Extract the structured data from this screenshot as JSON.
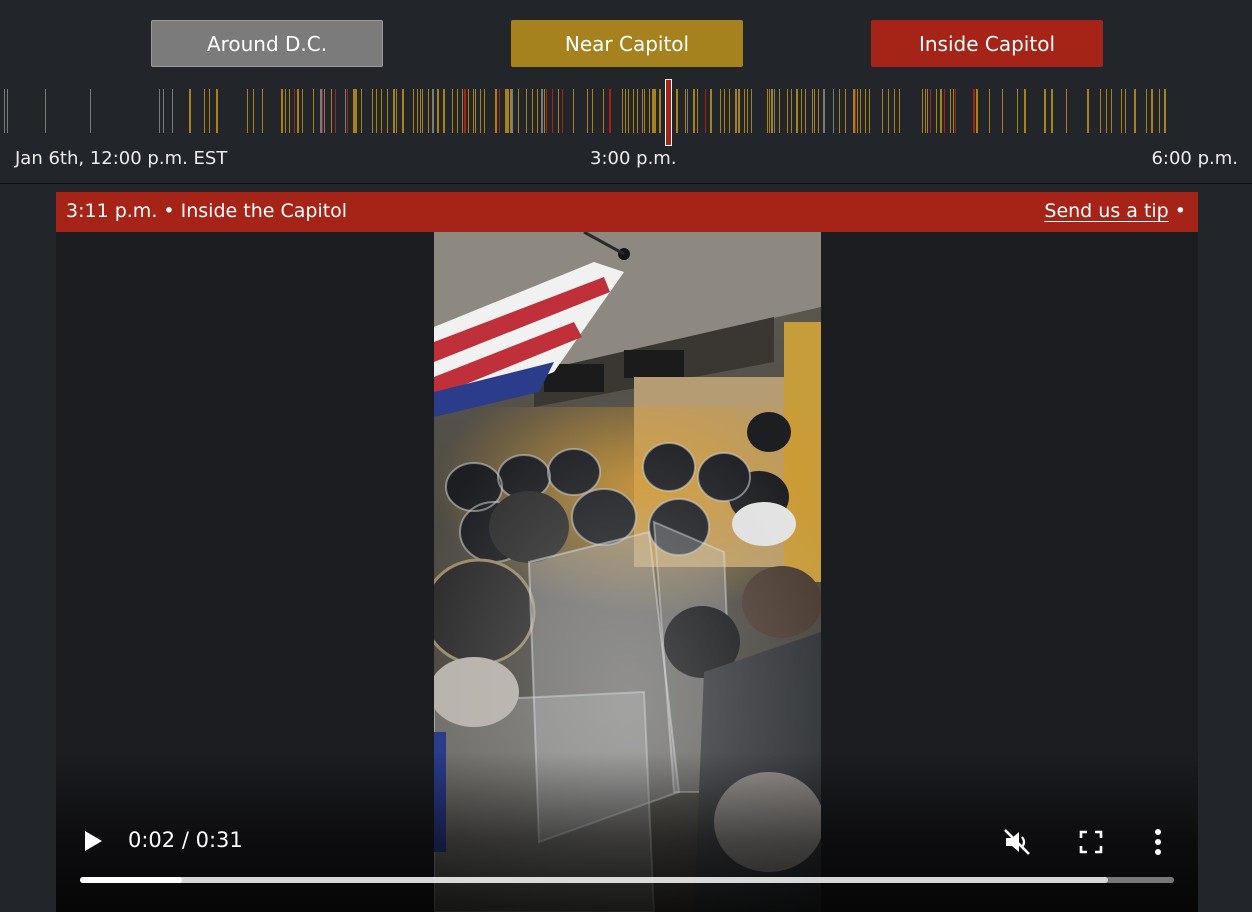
{
  "filters": {
    "around_dc": "Around D.C.",
    "near_capitol": "Near Capitol",
    "inside_capitol": "Inside Capitol"
  },
  "colors": {
    "around_dc": "#7b7b7b",
    "near_capitol": "#a6821e",
    "inside_capitol": "#a62417",
    "background": "#22252a"
  },
  "timeline": {
    "start_label": "Jan 6th, 12:00 p.m. EST",
    "mid_label": "3:00 p.m.",
    "end_label": "6:00 p.m."
  },
  "panel": {
    "title": "3:11 p.m. • Inside the Capitol",
    "tip_link": "Send us a tip",
    "tip_bullet": " •"
  },
  "video": {
    "time": "0:02 / 0:31",
    "progress": 0.093,
    "buffered": 0.94,
    "muted": true,
    "play_icon": "play-icon",
    "mute_icon": "muted-speaker-icon",
    "fullscreen_icon": "fullscreen-icon",
    "menu_icon": "more-vertical-icon"
  }
}
